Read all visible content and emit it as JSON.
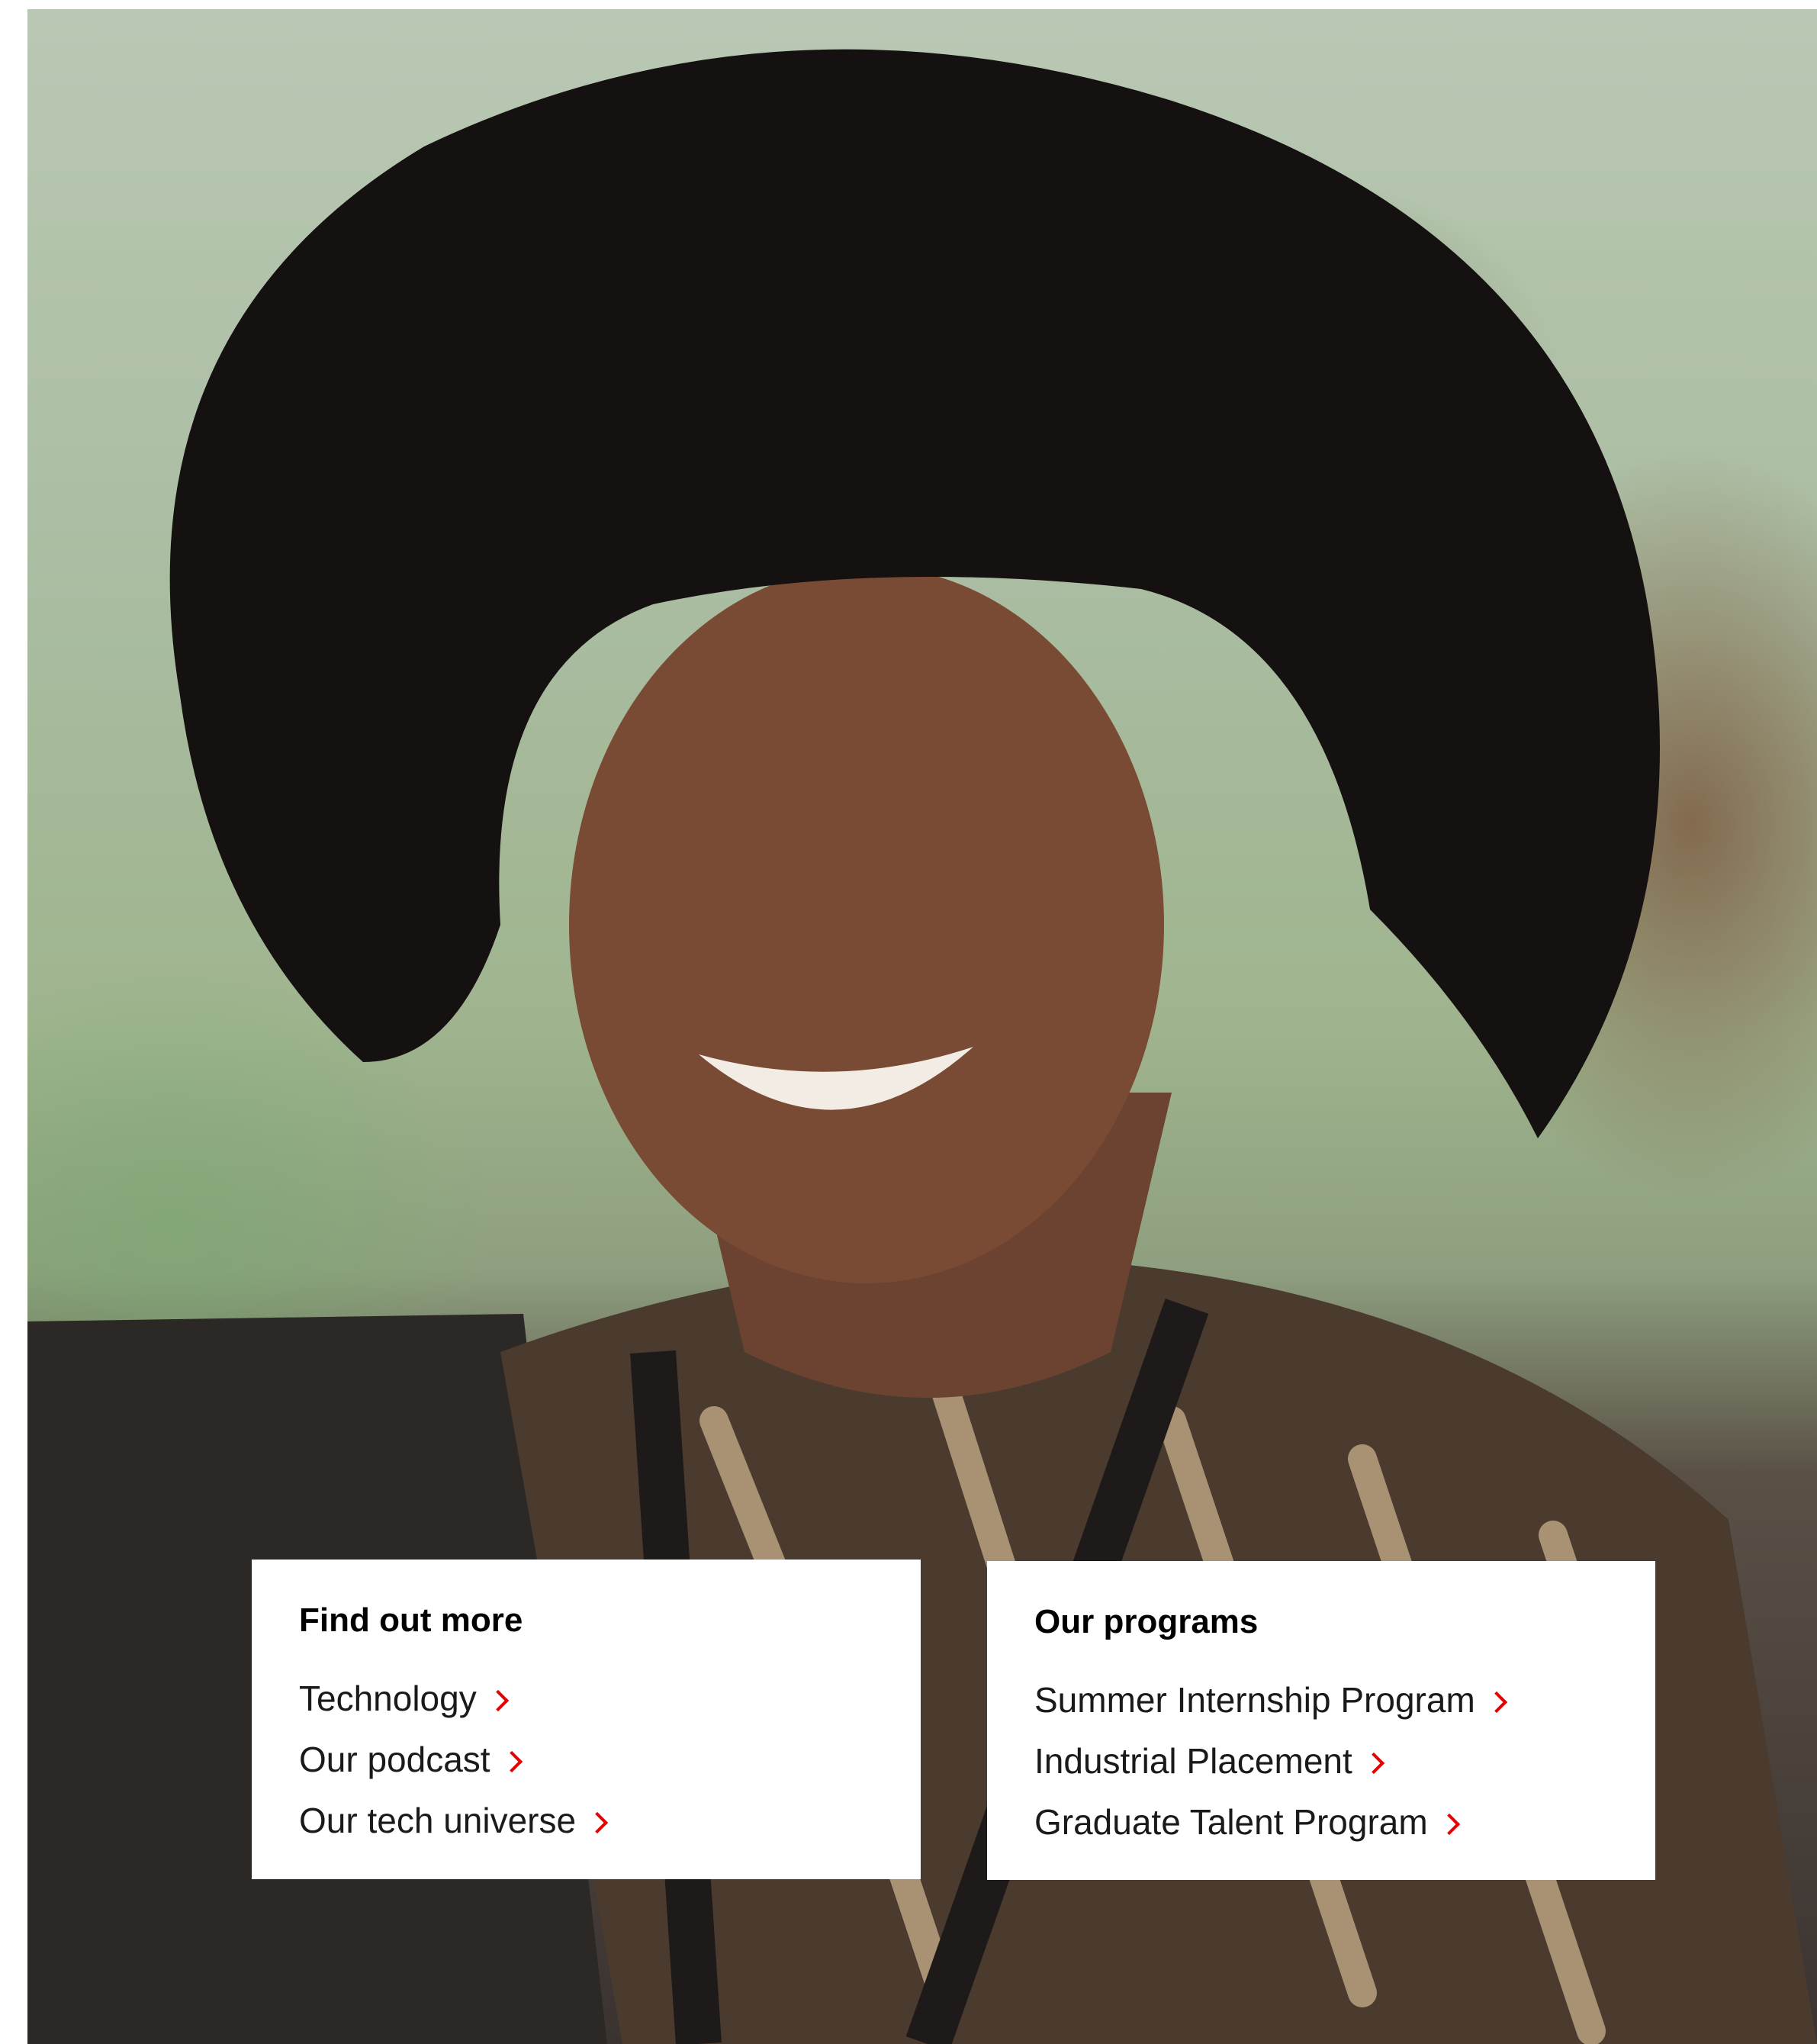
{
  "find_out_more": {
    "title": "Find out more",
    "links": [
      {
        "label": "Technology"
      },
      {
        "label": "Our podcast"
      },
      {
        "label": "Our tech universe"
      }
    ]
  },
  "our_programs": {
    "title": "Our programs",
    "links": [
      {
        "label": "Summer Internship Program"
      },
      {
        "label": "Industrial Placement"
      },
      {
        "label": "Graduate Talent Program"
      }
    ]
  },
  "colors": {
    "accent_chevron": "#e60000",
    "card_background": "#ffffff",
    "text": "#1a1a1a"
  },
  "icons": {
    "link_arrow": "chevron-right-icon"
  }
}
